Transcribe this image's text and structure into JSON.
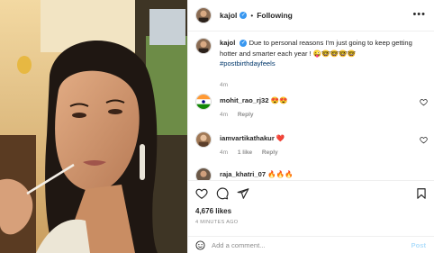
{
  "post": {
    "username": "kajol",
    "follow_label": "Following",
    "more_icon": "more-options-icon",
    "verified_icon": "verified-badge-icon"
  },
  "caption": {
    "username": "kajol",
    "text": "Due to personal reasons I'm just going to keep getting hotter and smarter each year ! 😜🤓🤓🤓🤓",
    "hashtag": "#postbirthdayfeels",
    "time": "4m"
  },
  "comments": [
    {
      "username": "mohit_rao_rj32",
      "text": "😍😍",
      "time": "4m",
      "reply_label": "Reply",
      "likes": ""
    },
    {
      "username": "iamvartikathakur",
      "text": "❤️",
      "time": "4m",
      "likes": "1 like",
      "reply_label": "Reply"
    },
    {
      "username": "raja_khatri_07",
      "text": "🔥🔥🔥",
      "time": "",
      "reply_label": "",
      "likes": ""
    }
  ],
  "actions": {
    "like_icon": "heart-icon",
    "comment_icon": "comment-bubble-icon",
    "share_icon": "paper-plane-icon",
    "save_icon": "bookmark-icon"
  },
  "likes_count": "4,676 likes",
  "post_time": "4 MINUTES AGO",
  "add_comment": {
    "placeholder": "Add a comment...",
    "post_label": "Post",
    "emoji_icon": "smiley-emoji-icon"
  },
  "colors": {
    "link_blue": "#00376b",
    "post_disabled": "#b2dffc",
    "verified_blue": "#3897f0",
    "muted": "#8e8e8e"
  }
}
